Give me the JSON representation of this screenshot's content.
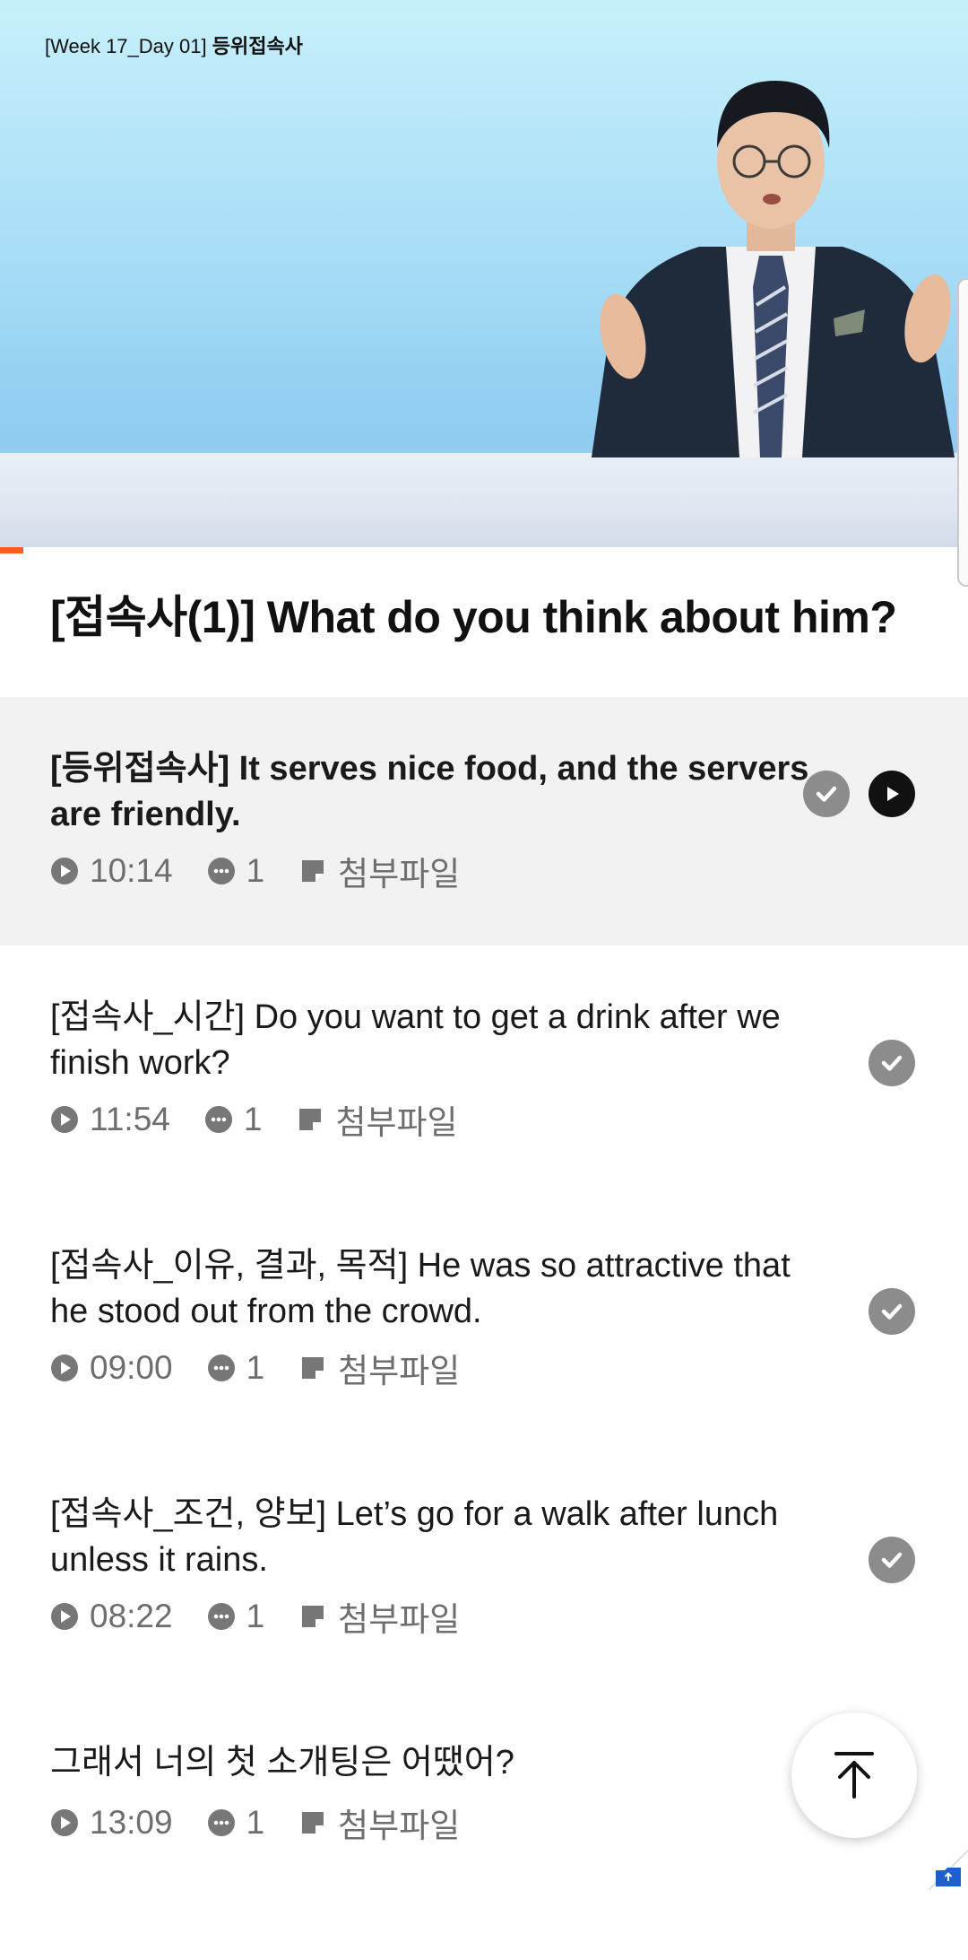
{
  "video": {
    "label_prefix": "[Week 17_Day 01]",
    "label_bold": "등위접속사"
  },
  "lesson_title": "[접속사(1)] What do you think about him?",
  "items": [
    {
      "title": "[등위접속사] It serves nice food, and the servers are friendly.",
      "duration": "10:14",
      "comments": "1",
      "attachment": "첨부파일",
      "active": true,
      "completed": true
    },
    {
      "title": "[접속사_시간] Do you want to get a drink after we finish work?",
      "duration": "11:54",
      "comments": "1",
      "attachment": "첨부파일",
      "active": false,
      "completed": true
    },
    {
      "title": "[접속사_이유, 결과, 목적] He was so attractive that he stood out from the crowd.",
      "duration": "09:00",
      "comments": "1",
      "attachment": "첨부파일",
      "active": false,
      "completed": true
    },
    {
      "title": "[접속사_조건, 양보] Let’s go for a walk after lunch unless it rains.",
      "duration": "08:22",
      "comments": "1",
      "attachment": "첨부파일",
      "active": false,
      "completed": true
    },
    {
      "title": "그래서 너의 첫 소개팅은 어땠어?",
      "duration": "13:09",
      "comments": "1",
      "attachment": "첨부파일",
      "active": false,
      "completed": false
    }
  ],
  "colors": {
    "accent": "#ff5a1f",
    "check": "#8c8c8c",
    "active_bg": "#f2f2f2"
  },
  "icons": {
    "play": "play-circle-icon",
    "comment": "comment-icon",
    "attachment": "note-icon",
    "check": "check-circle-icon",
    "scroll_top": "arrow-up-icon"
  }
}
